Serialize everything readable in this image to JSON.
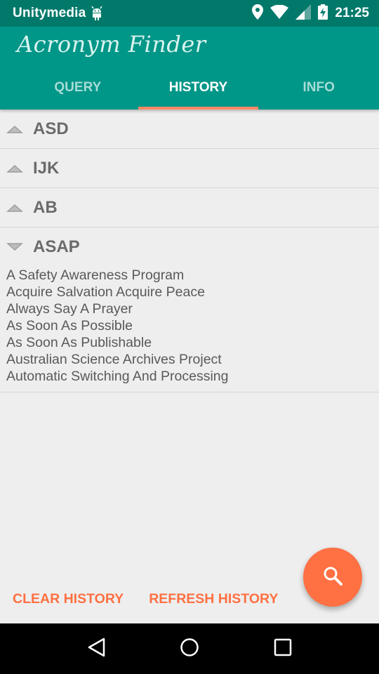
{
  "status_bar": {
    "carrier": "Unitymedia",
    "time": "21:25"
  },
  "app": {
    "title": "Acronym Finder"
  },
  "tabs": [
    {
      "label": "QUERY",
      "active": false
    },
    {
      "label": "HISTORY",
      "active": true
    },
    {
      "label": "INFO",
      "active": false
    }
  ],
  "history": {
    "groups": [
      {
        "label": "ASD",
        "expanded": false
      },
      {
        "label": "IJK",
        "expanded": false
      },
      {
        "label": "AB",
        "expanded": false
      },
      {
        "label": "ASAP",
        "expanded": true,
        "meanings": [
          "A Safety Awareness Program",
          "Acquire Salvation Acquire Peace",
          "Always Say A Prayer",
          "As Soon As Possible",
          "As Soon As Publishable",
          "Australian Science Archives Project",
          "Automatic Switching And Processing"
        ]
      }
    ]
  },
  "actions": {
    "clear_label": "CLEAR HISTORY",
    "refresh_label": "REFRESH HISTORY"
  },
  "icons": {
    "fab": "search-icon",
    "nav_back": "back-triangle-icon",
    "nav_home": "home-circle-icon",
    "nav_recents": "recents-square-icon"
  },
  "colors": {
    "status_bar": "#00796b",
    "primary": "#009688",
    "accent": "#ff7043",
    "tab_indicator": "#ff8a65",
    "background": "#eeeeee"
  }
}
